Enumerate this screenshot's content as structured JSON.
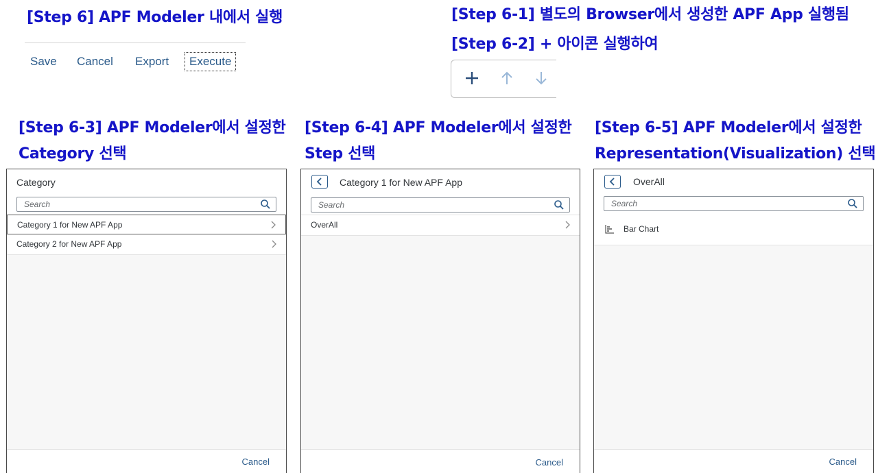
{
  "headings": {
    "step6": "[Step 6] APF Modeler 내에서 실행",
    "step6_1": "[Step 6-1] 별도의 Browser에서 생성한 APF App 실행됨",
    "step6_2": "[Step 6-2] + 아이콘 실행하여",
    "step6_3": [
      "[Step 6-3] APF Modeler에서 설정한",
      "Category 선택"
    ],
    "step6_4": [
      "[Step 6-4] APF Modeler에서 설정한",
      "Step 선택"
    ],
    "step6_5": [
      "[Step 6-5] APF Modeler에서 설정한",
      "Representation(Visualization) 선택"
    ]
  },
  "toolbar": {
    "save": "Save",
    "cancel": "Cancel",
    "export": "Export",
    "execute": "Execute"
  },
  "icons": {
    "add": "plus-icon",
    "up": "arrow-up-icon",
    "down": "arrow-down-icon"
  },
  "colors": {
    "heading": "#1515c8",
    "link": "#2a5a8a"
  },
  "panel_category": {
    "title": "Category",
    "search_placeholder": "Search",
    "items": [
      "Category 1 for New APF App",
      "Category 2 for New APF App"
    ],
    "cancel": "Cancel"
  },
  "panel_step": {
    "title": "Category 1 for New APF App",
    "search_placeholder": "Search",
    "items": [
      "OverAll"
    ],
    "cancel": "Cancel"
  },
  "panel_representation": {
    "title": "OverAll",
    "search_placeholder": "Search",
    "items": [
      "Bar Chart"
    ],
    "cancel": "Cancel"
  }
}
